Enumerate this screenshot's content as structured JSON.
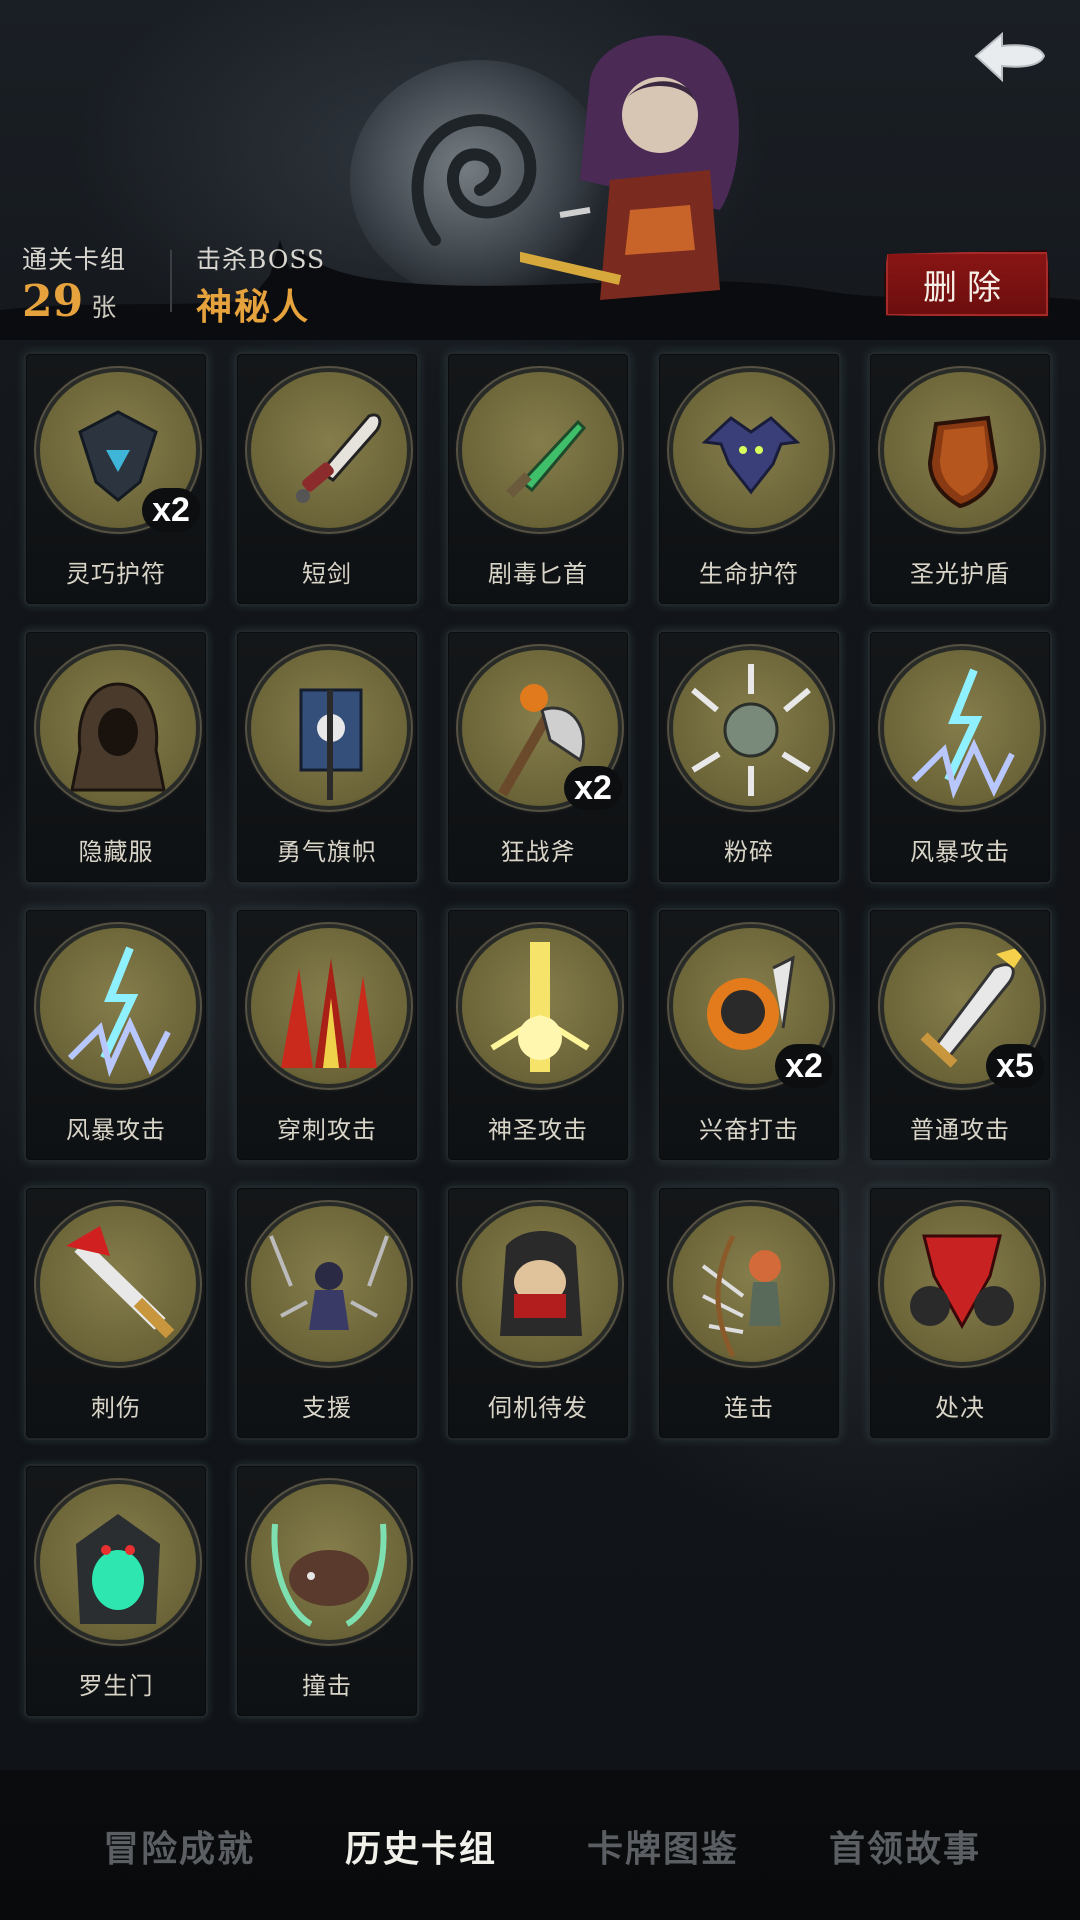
{
  "header": {
    "clear_deck_label": "通关卡组",
    "clear_deck_count": "29",
    "clear_deck_unit": "张",
    "boss_label": "击杀BOSS",
    "boss_name": "神秘人",
    "delete_label": "删除",
    "back_icon": "back-arrow-icon"
  },
  "colors": {
    "accent": "#e6a23c",
    "delete": "#8a1515",
    "medal": "#7a7244"
  },
  "cards": [
    {
      "name": "灵巧护符",
      "mult": "x2",
      "icon": "agility-amulet-icon"
    },
    {
      "name": "短剑",
      "mult": "",
      "icon": "short-sword-icon"
    },
    {
      "name": "剧毒匕首",
      "mult": "",
      "icon": "poison-dagger-icon"
    },
    {
      "name": "生命护符",
      "mult": "",
      "icon": "bat-amulet-icon"
    },
    {
      "name": "圣光护盾",
      "mult": "",
      "icon": "holy-shield-icon"
    },
    {
      "name": "隐藏服",
      "mult": "",
      "icon": "hooded-cloak-icon"
    },
    {
      "name": "勇气旗帜",
      "mult": "",
      "icon": "courage-banner-icon"
    },
    {
      "name": "狂战斧",
      "mult": "x2",
      "icon": "berserker-axe-icon"
    },
    {
      "name": "粉碎",
      "mult": "",
      "icon": "shatter-icon"
    },
    {
      "name": "风暴攻击",
      "mult": "",
      "icon": "storm-strike-icon"
    },
    {
      "name": "风暴攻击",
      "mult": "",
      "icon": "storm-strike-icon"
    },
    {
      "name": "穿刺攻击",
      "mult": "",
      "icon": "pierce-strike-icon"
    },
    {
      "name": "神圣攻击",
      "mult": "",
      "icon": "holy-strike-icon"
    },
    {
      "name": "兴奋打击",
      "mult": "x2",
      "icon": "frenzy-strike-icon"
    },
    {
      "name": "普通攻击",
      "mult": "x5",
      "icon": "basic-attack-icon"
    },
    {
      "name": "刺伤",
      "mult": "",
      "icon": "stab-icon"
    },
    {
      "name": "支援",
      "mult": "",
      "icon": "support-icon"
    },
    {
      "name": "伺机待发",
      "mult": "",
      "icon": "ambush-icon"
    },
    {
      "name": "连击",
      "mult": "",
      "icon": "combo-icon"
    },
    {
      "name": "处决",
      "mult": "",
      "icon": "execute-icon"
    },
    {
      "name": "罗生门",
      "mult": "",
      "icon": "demon-gate-icon"
    },
    {
      "name": "撞击",
      "mult": "",
      "icon": "charge-icon"
    }
  ],
  "tabs": [
    {
      "label": "冒险成就",
      "active": false
    },
    {
      "label": "历史卡组",
      "active": true
    },
    {
      "label": "卡牌图鉴",
      "active": false
    },
    {
      "label": "首领故事",
      "active": false
    }
  ]
}
